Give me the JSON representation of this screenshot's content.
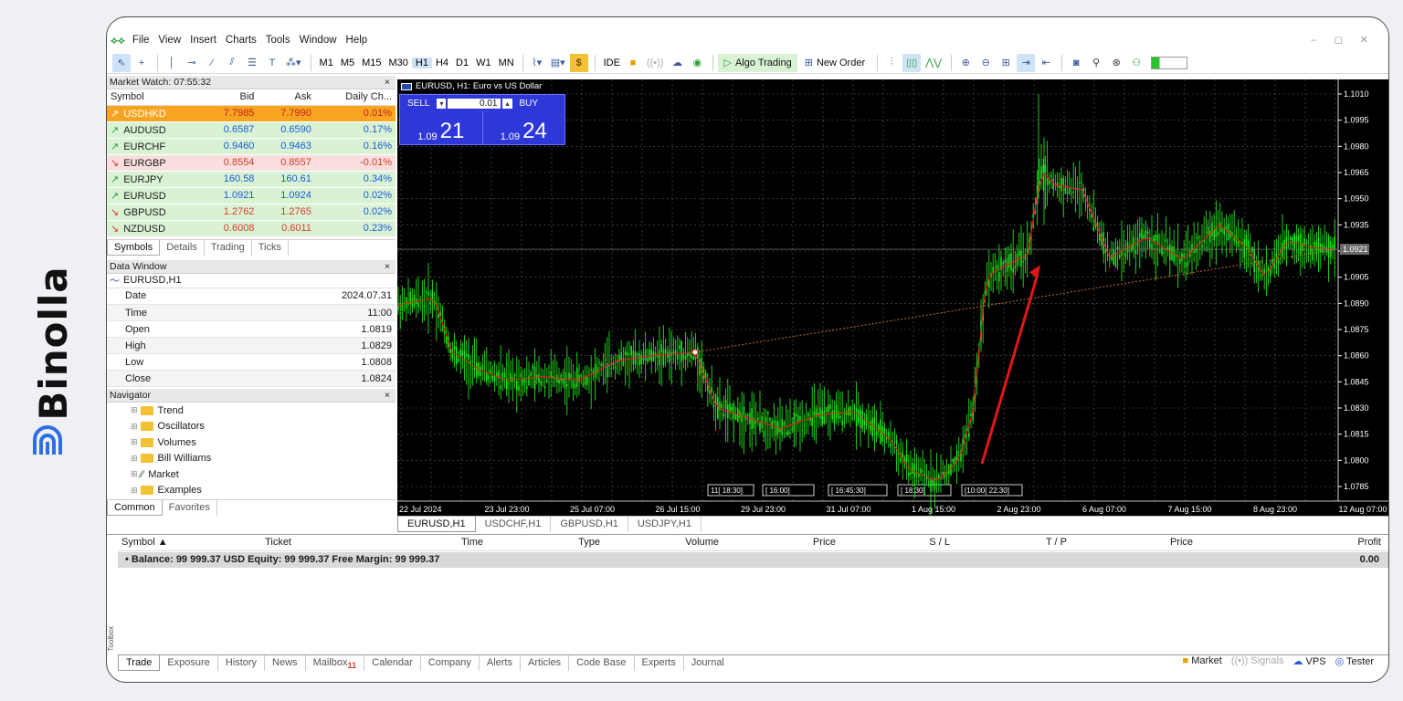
{
  "brand": {
    "name": "Binolla"
  },
  "menu": [
    "File",
    "View",
    "Insert",
    "Charts",
    "Tools",
    "Window",
    "Help"
  ],
  "window_controls": "– ◻ ✕",
  "toolbar": {
    "timeframes": [
      "M1",
      "M5",
      "M15",
      "M30",
      "H1",
      "H4",
      "D1",
      "W1",
      "MN"
    ],
    "active_timeframe": "H1",
    "ide_label": "IDE",
    "algo_trading_label": "Algo Trading",
    "new_order_label": "New Order"
  },
  "market_watch": {
    "title": "Market Watch: 07:55:32",
    "columns": [
      "Symbol",
      "Bid",
      "Ask",
      "Daily Ch..."
    ],
    "rows": [
      {
        "symbol": "USDHKD",
        "bid": "7.7985",
        "ask": "7.7990",
        "change": "0.01%",
        "dir": "up",
        "bg": "#f7a520"
      },
      {
        "symbol": "AUDUSD",
        "bid": "0.6587",
        "ask": "0.6590",
        "change": "0.17%",
        "dir": "up",
        "bg": "#d9f2d4"
      },
      {
        "symbol": "EURCHF",
        "bid": "0.9460",
        "ask": "0.9463",
        "change": "0.16%",
        "dir": "up",
        "bg": "#d9f2d4"
      },
      {
        "symbol": "EURGBP",
        "bid": "0.8554",
        "ask": "0.8557",
        "change": "-0.01%",
        "dir": "down",
        "bg": "#f9dede"
      },
      {
        "symbol": "EURJPY",
        "bid": "160.58",
        "ask": "160.61",
        "change": "0.34%",
        "dir": "up",
        "bg": "#d9f2d4"
      },
      {
        "symbol": "EURUSD",
        "bid": "1.0921",
        "ask": "1.0924",
        "change": "0.02%",
        "dir": "up",
        "bg": "#d9f2d4"
      },
      {
        "symbol": "GBPUSD",
        "bid": "1.2762",
        "ask": "1.2765",
        "change": "0.02%",
        "dir": "down",
        "bg": "#d9f2d4"
      },
      {
        "symbol": "NZDUSD",
        "bid": "0.6008",
        "ask": "0.6011",
        "change": "0.23%",
        "dir": "down",
        "bg": "#d9f2d4"
      }
    ],
    "tabs": [
      "Symbols",
      "Details",
      "Trading",
      "Ticks"
    ]
  },
  "data_window": {
    "title": "Data Window",
    "symbol": "EURUSD,H1",
    "rows": [
      {
        "label": "Date",
        "value": "2024.07.31"
      },
      {
        "label": "Time",
        "value": "11:00"
      },
      {
        "label": "Open",
        "value": "1.0819"
      },
      {
        "label": "High",
        "value": "1.0829"
      },
      {
        "label": "Low",
        "value": "1.0808"
      },
      {
        "label": "Close",
        "value": "1.0824"
      }
    ]
  },
  "navigator": {
    "title": "Navigator",
    "items": [
      "Trend",
      "Oscillators",
      "Volumes",
      "Bill Williams",
      "Market",
      "Examples"
    ],
    "tabs": [
      "Common",
      "Favorites"
    ]
  },
  "chart": {
    "header": "EURUSD, H1:  Euro vs US Dollar",
    "sell_label": "SELL",
    "buy_label": "BUY",
    "lot": "0.01",
    "sell_big": "21",
    "sell_small": "1.09",
    "buy_big": "24",
    "buy_small": "1.09",
    "price_labels": [
      "1.1010",
      "1.0995",
      "1.0980",
      "1.0965",
      "1.0950",
      "1.0935",
      "1.0920",
      "1.0905",
      "1.0890",
      "1.0875",
      "1.0860",
      "1.0845",
      "1.0830",
      "1.0815",
      "1.0800",
      "1.0785"
    ],
    "current_price": "1.0921",
    "time_labels": [
      "22 Jul 2024",
      "23 Jul 23:00",
      "25 Jul 07:00",
      "26 Jul 15:00",
      "29 Jul 23:00",
      "31 Jul 07:00",
      "1 Aug 15:00",
      "2 Aug 23:00",
      "6 Aug 07:00",
      "7 Aug 15:00",
      "8 Aug 23:00",
      "12 Aug 07:00"
    ],
    "period_markers": [
      "11[ 18:30]",
      "[ 16:00]",
      "[ 16:45:30]",
      "[ 18:30]",
      "[10:00[ 22:30]"
    ],
    "line_color": "#21e21a",
    "ma_color": "#e02020"
  },
  "chart_tabs": [
    "EURUSD,H1",
    "USDCHF,H1",
    "GBPUSD,H1",
    "USDJPY,H1"
  ],
  "toolbox": {
    "columns": [
      "Symbol ▲",
      "Ticket",
      "Time",
      "Type",
      "Volume",
      "Price",
      "S / L",
      "T / P",
      "Price",
      "Profit"
    ],
    "balance": "•  Balance: 99 999.37 USD  Equity: 99 999.37  Free Margin: 99 999.37",
    "profit": "0.00",
    "tabs": [
      "Trade",
      "Exposure",
      "History",
      "News",
      "Mailbox",
      "Calendar",
      "Company",
      "Alerts",
      "Articles",
      "Code Base",
      "Experts",
      "Journal"
    ],
    "mailbox_count": "11",
    "status": [
      "Market",
      "Signals",
      "VPS",
      "Tester"
    ],
    "side_label": "Toolbox"
  }
}
